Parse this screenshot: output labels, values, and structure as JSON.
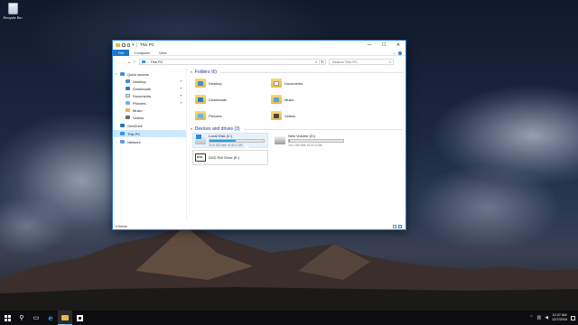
{
  "desktop": {
    "icons": [
      {
        "label": "Recycle Bin",
        "icon": "recycle-bin-icon"
      }
    ]
  },
  "window": {
    "title": "This PC",
    "controls": {
      "minimize": "—",
      "maximize": "☐",
      "close": "✕"
    },
    "ribbon_tabs": [
      "File",
      "Computer",
      "View"
    ],
    "address": {
      "back": "←",
      "forward": "→",
      "up_history": "⌄",
      "up": "↑",
      "path": "This PC",
      "refresh": "↻",
      "search_placeholder": "Search This PC"
    },
    "nav_pane": [
      {
        "label": "Quick access",
        "icon": "star-icon",
        "pinned": false,
        "selected": false
      },
      {
        "label": "Desktop",
        "icon": "desktop-folder-icon",
        "pinned": true,
        "selected": false
      },
      {
        "label": "Downloads",
        "icon": "download-folder-icon",
        "pinned": true,
        "selected": false
      },
      {
        "label": "Documents",
        "icon": "documents-folder-icon",
        "pinned": true,
        "selected": false
      },
      {
        "label": "Pictures",
        "icon": "pictures-folder-icon",
        "pinned": true,
        "selected": false
      },
      {
        "label": "Music",
        "icon": "music-folder-icon",
        "pinned": false,
        "selected": false
      },
      {
        "label": "Videos",
        "icon": "videos-folder-icon",
        "pinned": false,
        "selected": false
      },
      {
        "label": "OneDrive",
        "icon": "cloud-icon",
        "pinned": false,
        "selected": false
      },
      {
        "label": "This PC",
        "icon": "computer-icon",
        "pinned": false,
        "selected": true
      },
      {
        "label": "Network",
        "icon": "network-icon",
        "pinned": false,
        "selected": false
      }
    ],
    "folders_group": {
      "label": "Folders (6)",
      "items": [
        {
          "label": "Desktop",
          "icon": "desktop-folder-icon"
        },
        {
          "label": "Documents",
          "icon": "documents-folder-icon"
        },
        {
          "label": "Downloads",
          "icon": "download-folder-icon"
        },
        {
          "label": "Music",
          "icon": "music-folder-icon"
        },
        {
          "label": "Pictures",
          "icon": "pictures-folder-icon"
        },
        {
          "label": "Videos",
          "icon": "videos-folder-icon"
        }
      ]
    },
    "drives_group": {
      "label": "Devices and drives (3)",
      "items": [
        {
          "label": "Local Disk (C:)",
          "free_text": "20.6 GB free of 40.0 GB",
          "used_fraction": 0.485,
          "icon": "windows-drive-icon"
        },
        {
          "label": "New Volume (D:)",
          "free_text": "19.2 GB free of 19.3 GB",
          "used_fraction": 0.005,
          "icon": "hard-drive-icon"
        },
        {
          "label": "DVD RW Drive (E:)",
          "icon": "dvd-drive-icon"
        }
      ]
    },
    "status": "9 items"
  },
  "taskbar": {
    "clock_time": "12:47 AM",
    "clock_date": "12/7/2016",
    "accent": "#76b9ed"
  }
}
